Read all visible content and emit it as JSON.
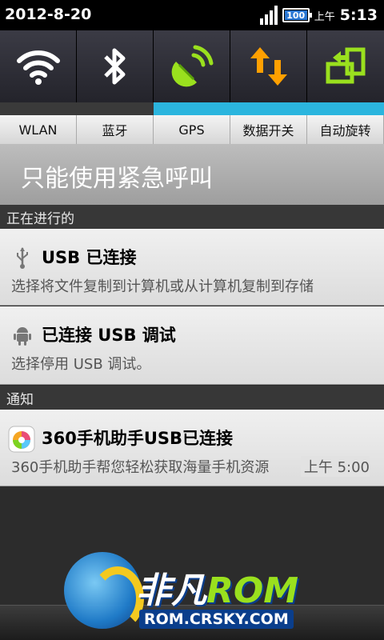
{
  "status_bar": {
    "date": "2012-8-20",
    "battery": "100",
    "ampm": "上午",
    "time": "5:13"
  },
  "toggles": [
    {
      "label": "WLAN",
      "icon": "wifi-icon",
      "on": false
    },
    {
      "label": "蓝牙",
      "icon": "bluetooth-icon",
      "on": false
    },
    {
      "label": "GPS",
      "icon": "gps-icon",
      "on": true
    },
    {
      "label": "数据开关",
      "icon": "data-arrows-icon",
      "on": true
    },
    {
      "label": "自动旋转",
      "icon": "rotate-icon",
      "on": true
    }
  ],
  "banner": "只能使用紧急呼叫",
  "ongoing_header": "正在进行的",
  "ongoing": [
    {
      "title": "USB 已连接",
      "subtitle": "选择将文件复制到计算机或从计算机复制到存储",
      "icon": "usb-icon"
    },
    {
      "title": "已连接 USB 调试",
      "subtitle": "选择停用 USB 调试。",
      "icon": "android-icon"
    }
  ],
  "notifications_header": "通知",
  "notifications": [
    {
      "title": "360手机助手USB已连接",
      "subtitle": "360手机助手帮您轻松获取海量手机资源",
      "time": "上午 5:00",
      "icon": "app-360-icon"
    }
  ],
  "watermark": {
    "brand": "非凡",
    "rom": "ROM",
    "url": "ROM.CRSKY.COM"
  },
  "colors": {
    "toggle_on": "#2bb5de",
    "toggle_off": "#3a3a3a",
    "icon_green": "#9ae01e",
    "icon_orange": "#ffa000"
  }
}
